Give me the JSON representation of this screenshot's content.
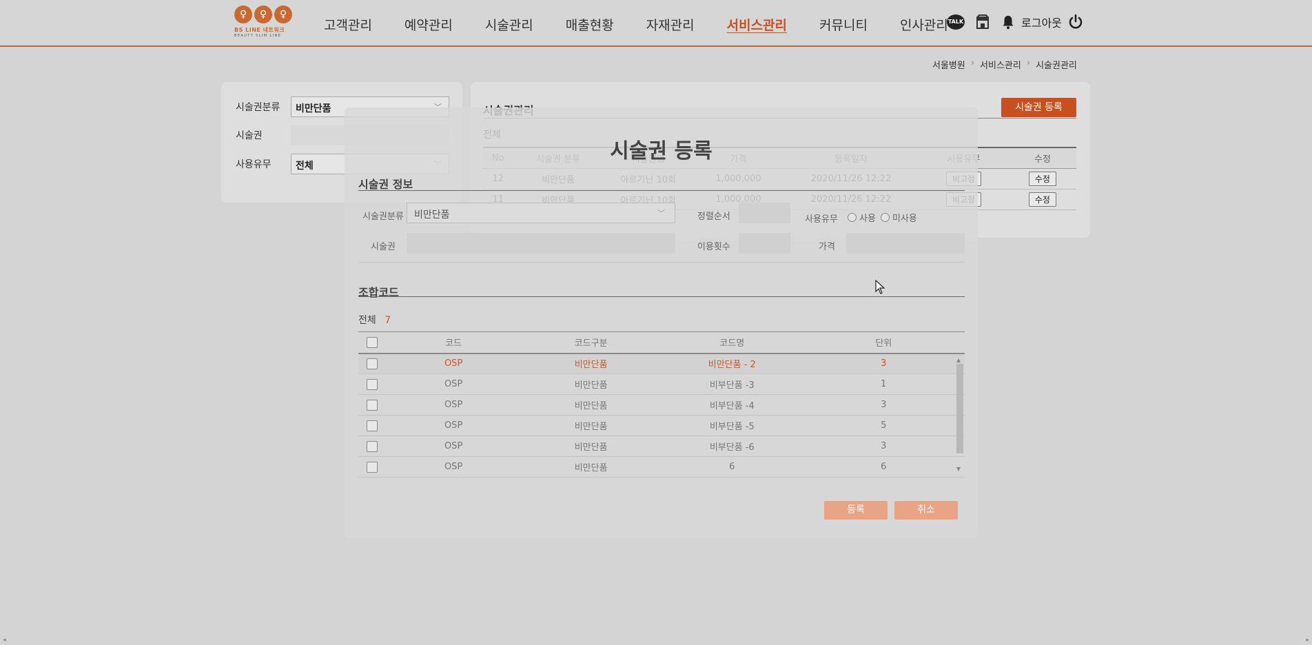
{
  "header": {
    "logo": {
      "brand": "BS LINE 네트워크",
      "tagline": "BEAUTY SLIM LINE"
    },
    "nav": [
      "고객관리",
      "예약관리",
      "시술관리",
      "매출현황",
      "자재관리",
      "서비스관리",
      "커뮤니티",
      "인사관리"
    ],
    "active_nav": "서비스관리",
    "talk_label": "TALK",
    "logout_label": "로그아웃"
  },
  "breadcrumb": [
    "서울병원",
    "서비스관리",
    "시술권관리"
  ],
  "filter": {
    "category_label": "시술권분류",
    "category_value": "비만단품",
    "ticket_label": "시술권",
    "usage_label": "사용유무",
    "usage_value": "전체"
  },
  "list": {
    "title": "시술권관리",
    "register_button": "시술권 등록",
    "total_label": "전체",
    "columns": [
      "No",
      "시술권 분류",
      "시술권명",
      "가격",
      "등록일자",
      "사용유무",
      "수정"
    ],
    "rows": [
      {
        "no": "12",
        "category": "비만단품",
        "name": "아르기닌 10회",
        "price": "1,000,000",
        "date": "2020/11/26 12:22",
        "usage": "비고정",
        "edit": "수정"
      },
      {
        "no": "11",
        "category": "비만단품",
        "name": "아르기닌 10회",
        "price": "1,000,000",
        "date": "2020/11/26 12:22",
        "usage": "비고정",
        "edit": "수정"
      }
    ]
  },
  "modal": {
    "title": "시술권 등록",
    "info_section": "시술권 정보",
    "category_label": "시술권분류",
    "category_value": "비만단품",
    "sort_label": "정렬순서",
    "usage_label": "사용유무",
    "radio_use": "사용",
    "radio_unused": "미사용",
    "ticket_label": "시술권",
    "count_label": "이용횟수",
    "price_label": "가격",
    "combo_section": "조합코드",
    "total_label": "전체",
    "total_count": "7",
    "columns": [
      "코드",
      "코드구분",
      "코드명",
      "단위"
    ],
    "rows": [
      {
        "code": "OSP",
        "type": "비만단품",
        "name": "비만단품 - 2",
        "unit": "3"
      },
      {
        "code": "OSP",
        "type": "비만단품",
        "name": "비부단품 -3",
        "unit": "1"
      },
      {
        "code": "OSP",
        "type": "비만단품",
        "name": "비부단품 -4",
        "unit": "3"
      },
      {
        "code": "OSP",
        "type": "비만단품",
        "name": "비부단품 -5",
        "unit": "5"
      },
      {
        "code": "OSP",
        "type": "비만단품",
        "name": "비부단품 -6",
        "unit": "3"
      },
      {
        "code": "OSP",
        "type": "비만단품",
        "name": "6",
        "unit": "6"
      }
    ],
    "submit_button": "등록",
    "cancel_button": "취소"
  },
  "colors": {
    "accent": "#c9501e",
    "accent_light": "#e8a485",
    "background": "#d4d4d4"
  }
}
